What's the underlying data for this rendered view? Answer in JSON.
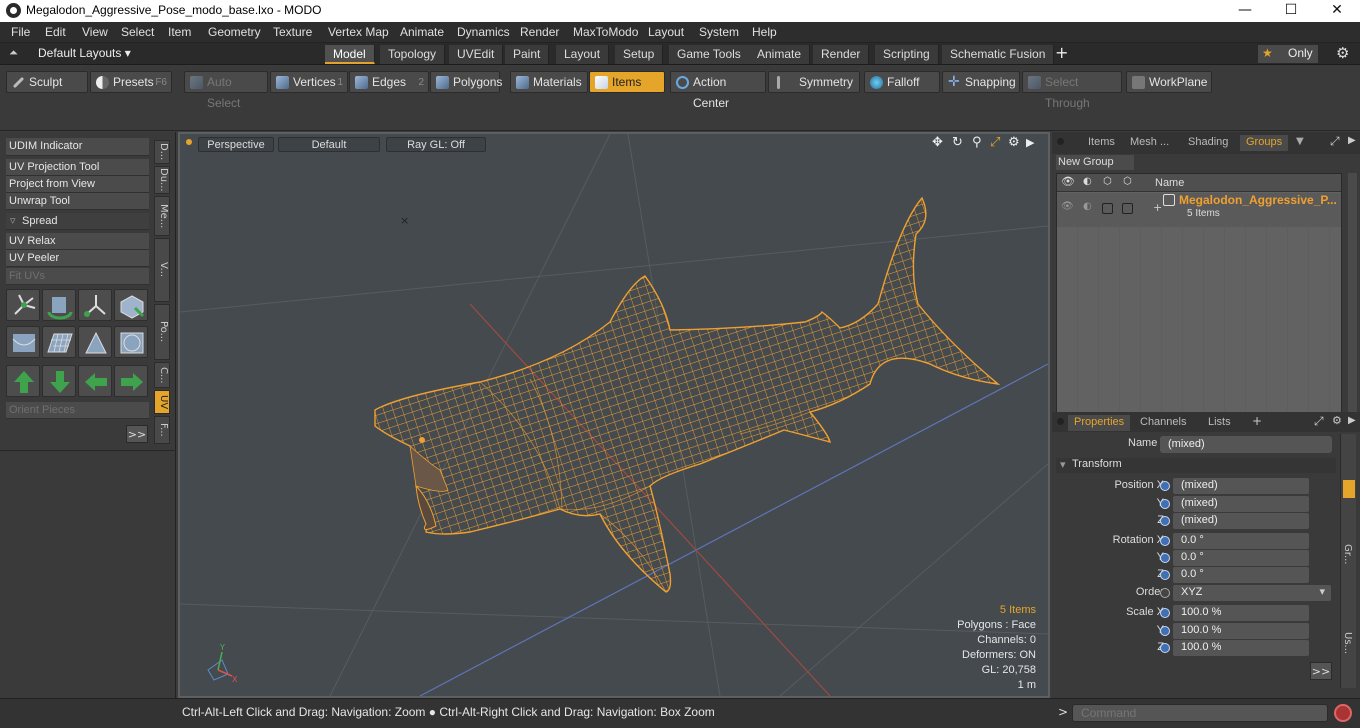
{
  "window": {
    "title": "Megalodon_Aggressive_Pose_modo_base.lxo - MODO",
    "minimize": "—",
    "maximize": "☐",
    "close": "✕"
  },
  "menu": [
    "File",
    "Edit",
    "View",
    "Select",
    "Item",
    "Geometry",
    "Texture",
    "Vertex Map",
    "Animate",
    "Dynamics",
    "Render",
    "MaxToModo",
    "Layout",
    "System",
    "Help"
  ],
  "layouts": {
    "selector": "Default Layouts",
    "tabs": [
      "Model",
      "Topology",
      "UVEdit",
      "Paint",
      "Layout",
      "Setup",
      "Game Tools",
      "Animate",
      "Render",
      "Scripting",
      "Schematic Fusion"
    ],
    "active_tab": "Model",
    "add": "+",
    "only": "Only"
  },
  "toolbar": {
    "sculpt": "Sculpt",
    "presets": "Presets",
    "presets_key": "F6",
    "auto_select": "Auto Select",
    "vertices": "Vertices",
    "vertices_key": "1",
    "edges": "Edges",
    "edges_key": "2",
    "polygons": "Polygons",
    "materials": "Materials",
    "items": "Items",
    "action_center": "Action Center",
    "symmetry": "Symmetry",
    "falloff": "Falloff",
    "snapping": "Snapping",
    "select_through": "Select Through",
    "workplane": "WorkPlane"
  },
  "left_panel": {
    "udim": "UDIM Indicator",
    "uv_projection": "UV Projection Tool",
    "project_from_view": "Project from View",
    "unwrap": "Unwrap Tool",
    "spread": "Spread",
    "uv_relax": "UV Relax",
    "uv_peeler": "UV Peeler",
    "fit_uvs": "Fit UVs",
    "orient_pieces": "Orient Pieces",
    "more": ">>",
    "vtabs": [
      "D...",
      "Du...",
      "Me...",
      "V...",
      "Po...",
      "C...",
      "UV",
      "F..."
    ]
  },
  "viewport": {
    "projection": "Perspective",
    "shading": "Default",
    "raygl": "Ray GL: Off",
    "info": {
      "items": "5 Items",
      "polygons": "Polygons : Face",
      "channels": "Channels: 0",
      "deformers": "Deformers: ON",
      "gl": "GL: 20,758",
      "scale": "1 m"
    }
  },
  "groups_panel": {
    "tabs": [
      "Items",
      "Mesh ...",
      "Shading",
      "Groups"
    ],
    "active_tab": "Groups",
    "new_group": "New Group",
    "col_name": "Name",
    "group_name": "Megalodon_Aggressive_P...",
    "group_count": "5 Items"
  },
  "properties_panel": {
    "tabs": [
      "Properties",
      "Channels",
      "Lists"
    ],
    "active_tab": "Properties",
    "name_label": "Name",
    "name_value": "(mixed)",
    "transform": "Transform",
    "position_x_label": "Position X",
    "position_x": "(mixed)",
    "position_y": "(mixed)",
    "position_z": "(mixed)",
    "rotation_x_label": "Rotation X",
    "rotation_x": "0.0 °",
    "rotation_y": "0.0 °",
    "rotation_z": "0.0 °",
    "order_label": "Order",
    "order_value": "XYZ",
    "scale_x_label": "Scale X",
    "scale_x": "100.0 %",
    "scale_y": "100.0 %",
    "scale_z": "100.0 %",
    "y_label": "Y",
    "z_label": "Z",
    "more": ">>",
    "side_tabs": [
      "Gr...",
      "Us..."
    ]
  },
  "statusbar": {
    "hint": "Ctrl-Alt-Left Click and Drag: Navigation: Zoom ● Ctrl-Alt-Right Click and Drag: Navigation: Box Zoom",
    "prompt": ">",
    "command_placeholder": "Command"
  },
  "colors": {
    "accent": "#e5a52b",
    "mesh": "#f0a030",
    "viewport_bg": "#444a4e"
  }
}
